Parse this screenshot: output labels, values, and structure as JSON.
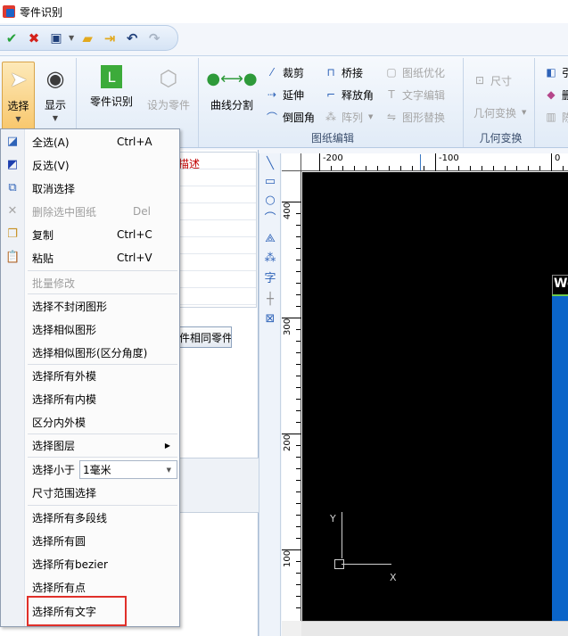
{
  "window": {
    "title": "零件识别"
  },
  "quickbar": {
    "icons": [
      "check-icon",
      "cross-icon",
      "save-icon",
      "open-folder-icon",
      "export-icon",
      "undo-icon",
      "redo-icon"
    ]
  },
  "ribbon": {
    "select": "选择",
    "display": "显示",
    "part_recognition": "零件识别",
    "set_as_part": "设为零件",
    "curve_split": "曲线分割",
    "trim": "裁剪",
    "bridge": "桥接",
    "optimize": "图纸优化",
    "extend": "延伸",
    "release_radius": "释放角",
    "text_edit": "文字编辑",
    "fillet": "倒圆角",
    "array": "阵列",
    "shape_replace": "图形替换",
    "group_drawing_edit": "图纸编辑",
    "dimension": "尺寸",
    "geometry_transform": "几何变换",
    "group_geometry": "几何变换",
    "cut_off_1": "引",
    "cut_off_2": "删",
    "cut_off_3": "陈"
  },
  "left_panel": {
    "description_header": "描述",
    "same_parts_button": "件相同零件"
  },
  "menu": {
    "select_all": "全选(A)",
    "select_all_shortcut": "Ctrl+A",
    "invert": "反选(V)",
    "cancel_select": "取消选择",
    "delete_selected": "删除选中图纸",
    "delete_shortcut": "Del",
    "copy": "复制",
    "copy_shortcut": "Ctrl+C",
    "paste": "粘贴",
    "paste_shortcut": "Ctrl+V",
    "batch_modify": "批量修改",
    "select_unclosed": "选择不封闭图形",
    "select_similar": "选择相似图形",
    "select_similar_angle": "选择相似图形(区分角度)",
    "select_outer": "选择所有外模",
    "select_inner": "选择所有内模",
    "split_inner_outer": "区分内外模",
    "select_layer": "选择图层",
    "select_smaller": "选择小于",
    "smaller_value": "1毫米",
    "size_range": "尺寸范围选择",
    "select_polylines": "选择所有多段线",
    "select_circles": "选择所有圆",
    "select_bezier": "选择所有bezier",
    "select_points": "选择所有点",
    "select_text": "选择所有文字"
  },
  "canvas": {
    "ruler_top": [
      "-200",
      "-100",
      "0"
    ],
    "ruler_left": [
      "400",
      "300",
      "200",
      "100"
    ],
    "part_label": "We",
    "axis_x": "X",
    "axis_y": "Y"
  },
  "colors": {
    "canvas_bg": "#000000",
    "part_fill": "#0a64c8",
    "highlight": "#e0302a"
  }
}
